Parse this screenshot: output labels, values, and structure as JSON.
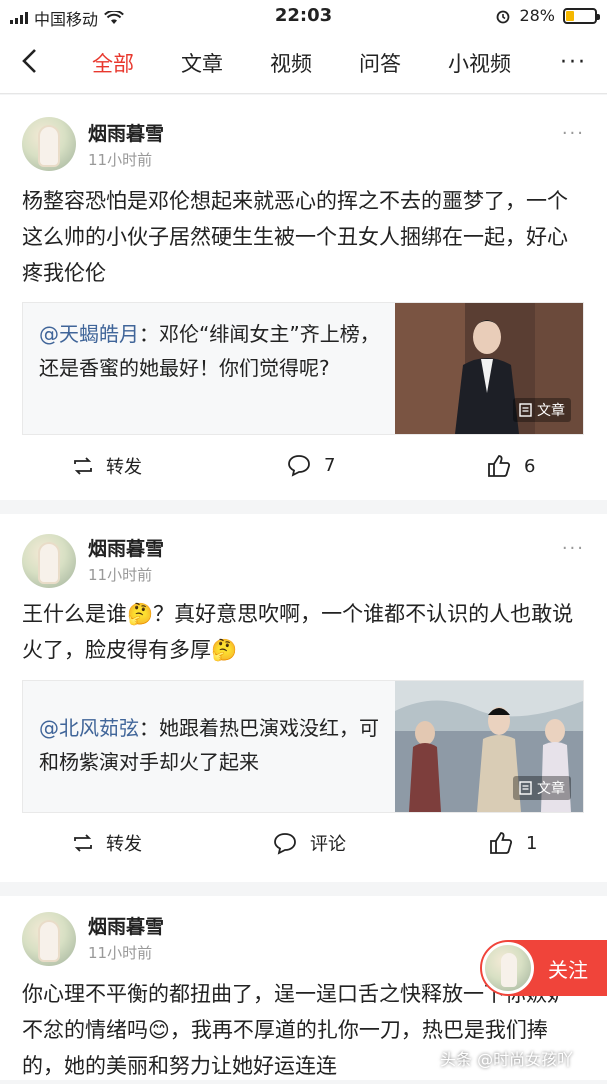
{
  "status_bar": {
    "carrier": "中国移动",
    "time": "22:03",
    "battery_pct": "28%",
    "battery_level": 0.28
  },
  "nav": {
    "tabs": [
      {
        "label": "全部",
        "active": true
      },
      {
        "label": "文章",
        "active": false
      },
      {
        "label": "视频",
        "active": false
      },
      {
        "label": "问答",
        "active": false
      },
      {
        "label": "小视频",
        "active": false
      }
    ],
    "more": "···"
  },
  "posts": [
    {
      "username": "烟雨暮雪",
      "time": "11小时前",
      "text": "杨整容恐怕是邓伦想起来就恶心的挥之不去的噩梦了，一个这么帅的小伙子居然硬生生被一个丑女人捆绑在一起，好心疼我伦伦",
      "quote": {
        "at": "@天蝎皓月",
        "text": "：邓伦“绯闻女主”齐上榜，还是香蜜的她最好！你们觉得呢?",
        "badge": "文章"
      },
      "actions": {
        "repost": "转发",
        "comments": "7",
        "likes": "6"
      }
    },
    {
      "username": "烟雨暮雪",
      "time": "11小时前",
      "text": "王什么是谁🤔？真好意思吹啊，一个谁都不认识的人也敢说火了，脸皮得有多厚🤔",
      "quote": {
        "at": "@北风茹弦",
        "text": "：她跟着热巴演戏没红，可和杨紫演对手却火了起来",
        "badge": "文章"
      },
      "actions": {
        "repost": "转发",
        "comments": "评论",
        "likes": "1"
      }
    },
    {
      "username": "烟雨暮雪",
      "time": "11小时前",
      "text": "你心理不平衡的都扭曲了，逞一逞口舌之快释放一下你嫉妒不忿的情绪吗😊，我再不厚道的扎你一刀，热巴是我们捧的，她的美丽和努力让她好运连连"
    }
  ],
  "follow_button": "关注",
  "watermark": "头条 @时尚女孩吖"
}
